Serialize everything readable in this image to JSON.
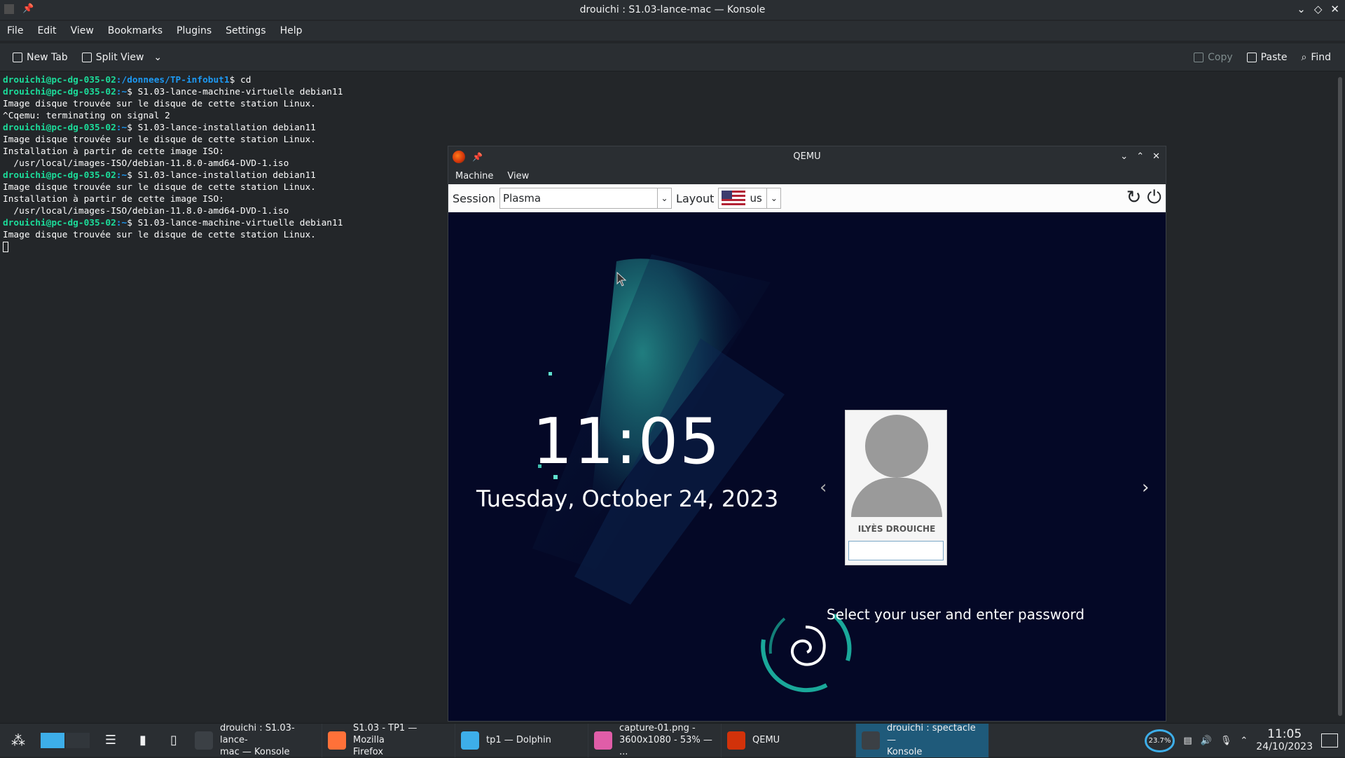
{
  "window": {
    "title": "drouichi : S1.03-lance-mac — Konsole",
    "menu": [
      "File",
      "Edit",
      "View",
      "Bookmarks",
      "Plugins",
      "Settings",
      "Help"
    ],
    "toolbar": {
      "new_tab": "New Tab",
      "split_view": "Split View",
      "copy": "Copy",
      "paste": "Paste",
      "find": "Find"
    }
  },
  "terminal": {
    "lines": [
      {
        "user": "drouichi@pc-dg-035-02",
        "path": ":/donnees/TP-infobut1",
        "cmd": "$ cd"
      },
      {
        "user": "drouichi@pc-dg-035-02",
        "path": ":~",
        "cmd": "$ S1.03-lance-machine-virtuelle debian11"
      },
      {
        "text": "Image disque trouvée sur le disque de cette station Linux."
      },
      {
        "text": "^Cqemu: terminating on signal 2"
      },
      {
        "user": "drouichi@pc-dg-035-02",
        "path": ":~",
        "cmd": "$ S1.03-lance-installation debian11"
      },
      {
        "text": "Image disque trouvée sur le disque de cette station Linux."
      },
      {
        "text": "Installation à partir de cette image ISO:"
      },
      {
        "text": "  /usr/local/images-ISO/debian-11.8.0-amd64-DVD-1.iso"
      },
      {
        "user": "drouichi@pc-dg-035-02",
        "path": ":~",
        "cmd": "$ S1.03-lance-installation debian11"
      },
      {
        "text": "Image disque trouvée sur le disque de cette station Linux."
      },
      {
        "text": "Installation à partir de cette image ISO:"
      },
      {
        "text": "  /usr/local/images-ISO/debian-11.8.0-amd64-DVD-1.iso"
      },
      {
        "user": "drouichi@pc-dg-035-02",
        "path": ":~",
        "cmd": "$ S1.03-lance-machine-virtuelle debian11"
      },
      {
        "text": "Image disque trouvée sur le disque de cette station Linux."
      }
    ]
  },
  "qemu": {
    "title": "QEMU",
    "menu": [
      "Machine",
      "View"
    ],
    "session_label": "Session",
    "session_value": "Plasma",
    "layout_label": "Layout",
    "layout_value": "us",
    "clock": "11:05",
    "date": "Tuesday, October 24, 2023",
    "user_name": "ILYÈS DROUICHE",
    "hint": "Select your user and enter password"
  },
  "taskbar": {
    "tasks": [
      {
        "label1": "drouichi : S1.03-lance-",
        "label2": "mac — Konsole",
        "color": "#3b4045"
      },
      {
        "label1": "S1.03 - TP1 — Mozilla",
        "label2": "Firefox",
        "color": "#ff7139"
      },
      {
        "label1": "tp1 — Dolphin",
        "label2": "",
        "color": "#3daee9"
      },
      {
        "label1": "capture-01.png -",
        "label2": "3600x1080 - 53% — ...",
        "color": "#e05da8"
      },
      {
        "label1": "QEMU",
        "label2": "",
        "color": "#d2320a"
      },
      {
        "label1": "drouichi : spectacle —",
        "label2": "Konsole",
        "color": "#3b4045"
      }
    ],
    "cpu": "23.7%",
    "time": "11:05",
    "date": "24/10/2023"
  }
}
